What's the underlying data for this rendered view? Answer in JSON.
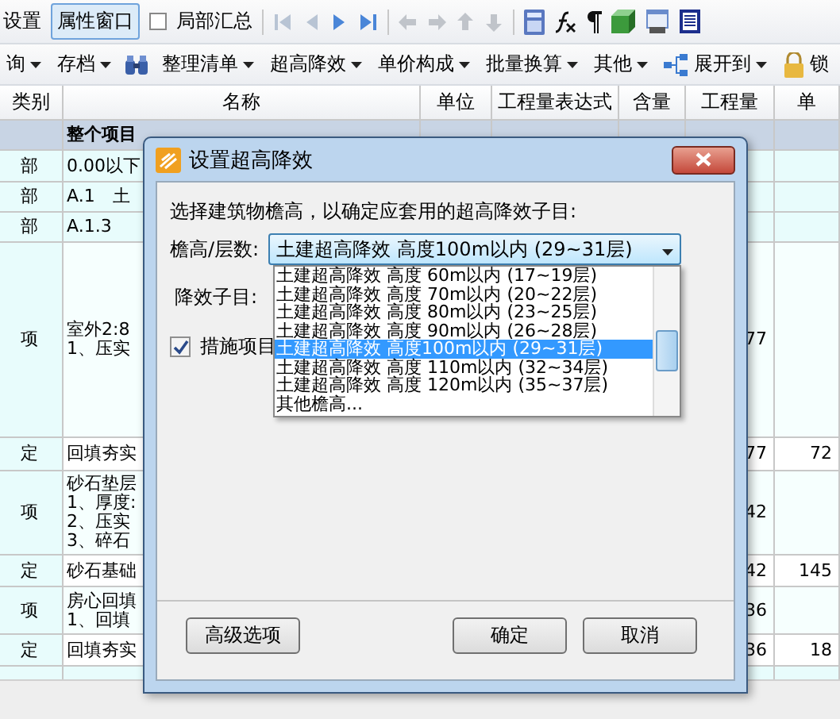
{
  "toolbar_top": {
    "items": [
      {
        "kind": "text",
        "label": "设置"
      },
      {
        "kind": "toggle",
        "label": "属性窗口",
        "selected": true
      },
      {
        "kind": "check",
        "label": "局部汇总",
        "checked": false
      }
    ]
  },
  "toolbar_menu": {
    "items": [
      {
        "kind": "menu",
        "label": "询"
      },
      {
        "kind": "menu",
        "label": "存档"
      },
      {
        "kind": "icon"
      },
      {
        "kind": "menu",
        "label": "整理清单"
      },
      {
        "kind": "menu",
        "label": "超高降效"
      },
      {
        "kind": "menu",
        "label": "单价构成"
      },
      {
        "kind": "menu",
        "label": "批量换算"
      },
      {
        "kind": "menu",
        "label": "其他"
      },
      {
        "kind": "menu_icon",
        "label": "展开到"
      },
      {
        "kind": "lock",
        "label": "锁"
      }
    ]
  },
  "table": {
    "columns": [
      "类别",
      "名称",
      "单位",
      "工程量表达式",
      "含量",
      "工程量",
      "单"
    ],
    "rows": [
      {
        "kind": "group",
        "type": "",
        "name": "整个项目",
        "qty": "",
        "price": ""
      },
      {
        "kind": "section",
        "type": "部",
        "name": "0.00以下",
        "qty": "",
        "price": ""
      },
      {
        "kind": "section",
        "type": "部",
        "name": "A.1　土",
        "qty": "",
        "price": ""
      },
      {
        "kind": "section",
        "type": "部",
        "name": "A.1.3　",
        "qty": "",
        "price": ""
      },
      {
        "kind": "item",
        "type": "项",
        "name": "室外2:8\n1、压实",
        "qty": "77",
        "price": ""
      },
      {
        "kind": "quota",
        "type": "定",
        "name": "回填夯实",
        "qty": "77",
        "price": "72"
      },
      {
        "kind": "item",
        "type": "项",
        "name": "砂石垫层\n1、厚度:\n2、压实\n3、碎石",
        "qty": "42",
        "price": ""
      },
      {
        "kind": "quota",
        "type": "定",
        "name": "砂石基础",
        "qty": "42",
        "price": "145"
      },
      {
        "kind": "item",
        "type": "项",
        "name": "房心回填\n1、回填",
        "qty": "36",
        "price": ""
      },
      {
        "kind": "quota",
        "type": "定",
        "name": "回填夯实",
        "qty": "36",
        "price": "18"
      }
    ]
  },
  "dialog": {
    "title": "设置超高降效",
    "prompt": "选择建筑物檐高，以确定应套用的超高降效子目:",
    "height_label": "檐高/层数:",
    "height_value": "土建超高降效 高度100m以内 (29~31层)",
    "options": [
      {
        "label": "土建超高降效 高度 60m以内 (17~19层)",
        "selected": false
      },
      {
        "label": "土建超高降效 高度 70m以内 (20~22层)",
        "selected": false
      },
      {
        "label": "土建超高降效 高度 80m以内 (23~25层)",
        "selected": false
      },
      {
        "label": "土建超高降效 高度 90m以内 (26~28层)",
        "selected": false
      },
      {
        "label": "土建超高降效 高度100m以内 (29~31层)",
        "selected": true
      },
      {
        "label": "土建超高降效 高度 110m以内 (32~34层)",
        "selected": false
      },
      {
        "label": "土建超高降效 高度 120m以内 (35~37层)",
        "selected": false
      },
      {
        "label": "其他檐高...",
        "selected": false
      }
    ],
    "sub_label": "降效子目:",
    "measure": {
      "label": "措施项目",
      "checked": true
    },
    "buttons": [
      "高级选项",
      "确定",
      "取消"
    ]
  }
}
